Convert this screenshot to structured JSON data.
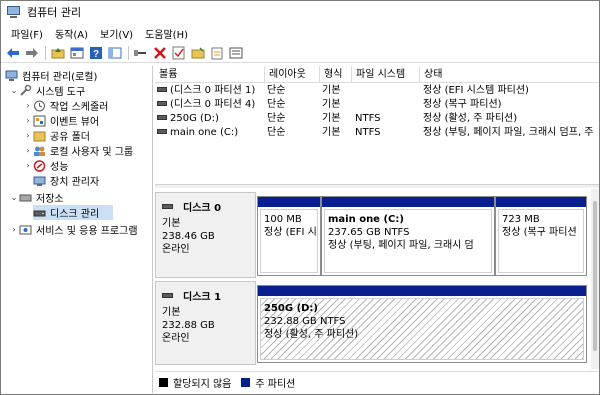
{
  "window": {
    "title": "컴퓨터 관리"
  },
  "menu": [
    "파일(F)",
    "동작(A)",
    "보기(V)",
    "도움말(H)"
  ],
  "toolbar": [
    "back-icon",
    "forward-icon",
    "up-folder-icon",
    "properties-icon",
    "help-icon",
    "show-hide-icon",
    "connect-icon",
    "delete-icon",
    "check-icon",
    "open-folder-icon",
    "export-icon",
    "view-icon"
  ],
  "tree": {
    "root": "컴퓨터 관리(로컬)",
    "system_tools": "시스템 도구",
    "task_scheduler": "작업 스케줄러",
    "event_viewer": "이벤트 뷰어",
    "shared_folders": "공유 폴더",
    "local_users": "로컬 사용자 및 그룹",
    "performance": "성능",
    "device_manager": "장치 관리자",
    "storage": "저장소",
    "disk_management": "디스크 관리",
    "services": "서비스 및 응용 프로그램"
  },
  "volume_list": {
    "headers": [
      "볼륨",
      "레이아웃",
      "형식",
      "파일 시스템",
      "상태"
    ],
    "rows": [
      {
        "volume": "(디스크 0 파티션 1)",
        "layout": "단순",
        "type": "기본",
        "fs": "",
        "status": "정상 (EFI 시스템 파티션)"
      },
      {
        "volume": "(디스크 0 파티션 4)",
        "layout": "단순",
        "type": "기본",
        "fs": "",
        "status": "정상 (복구 파티션)"
      },
      {
        "volume": "250G (D:)",
        "layout": "단순",
        "type": "기본",
        "fs": "NTFS",
        "status": "정상 (활성, 주 파티션)"
      },
      {
        "volume": "main one (C:)",
        "layout": "단순",
        "type": "기본",
        "fs": "NTFS",
        "status": "정상 (부팅, 페이지 파일, 크래시 덤프, 주"
      }
    ]
  },
  "disks": [
    {
      "name": "디스크 0",
      "kind": "기본",
      "size": "238.46 GB",
      "state": "온라인",
      "partitions": [
        {
          "name": "",
          "size": "100 MB",
          "status": "정상 (EFI 시"
        },
        {
          "name": "main one  (C:)",
          "size": "237.65 GB NTFS",
          "status": "정상 (부팅, 페이지 파일, 크래시 덤"
        },
        {
          "name": "",
          "size": "723 MB",
          "status": "정상 (복구 파티션"
        }
      ]
    },
    {
      "name": "디스크 1",
      "kind": "기본",
      "size": "232.88 GB",
      "state": "온라인",
      "partitions": [
        {
          "name": "250G  (D:)",
          "size": "232.88 GB NTFS",
          "status": "정상 (활성, 주 파티션)"
        }
      ]
    }
  ],
  "legend": [
    {
      "label": "할당되지 않음",
      "color": "#000000"
    },
    {
      "label": "주 파티션",
      "color": "#0a1f8f"
    }
  ]
}
